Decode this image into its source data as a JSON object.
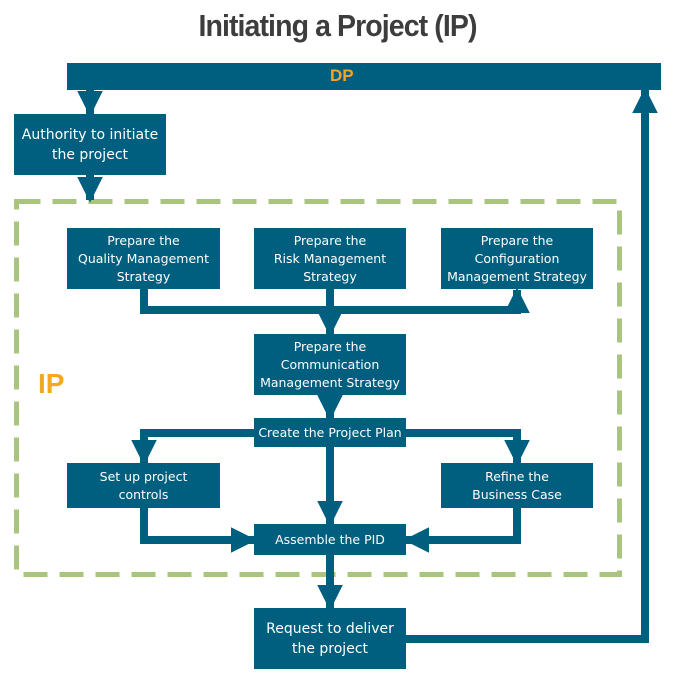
{
  "title": "Initiating a Project (IP)",
  "colors": {
    "box": "#005f7f",
    "box_text": "#ffffff",
    "accent_label": "#f5a623",
    "dashed_border": "#a8c47e",
    "title": "#3d3d3d"
  },
  "dp_bar": {
    "label": "DP"
  },
  "ip_region": {
    "label": "IP"
  },
  "nodes": {
    "authority": "Authority to initiate\nthe project",
    "quality": "Prepare the\nQuality Management\nStrategy",
    "risk": "Prepare the\nRisk Management\nStrategy",
    "configuration": "Prepare the\nConfiguration\nManagement Strategy",
    "communication": "Prepare the\nCommunication\nManagement Strategy",
    "project_plan": "Create the Project Plan",
    "controls": "Set up project\ncontrols",
    "business_case": "Refine the\nBusiness Case",
    "assemble_pid": "Assemble the PID",
    "request_deliver": "Request to deliver\nthe project"
  },
  "edges": [
    [
      "DP",
      "authority"
    ],
    [
      "authority",
      "IP"
    ],
    [
      "quality",
      "communication"
    ],
    [
      "risk",
      "communication"
    ],
    [
      "quality",
      "configuration"
    ],
    [
      "communication",
      "project_plan"
    ],
    [
      "project_plan",
      "controls"
    ],
    [
      "project_plan",
      "business_case"
    ],
    [
      "project_plan",
      "assemble_pid"
    ],
    [
      "controls",
      "assemble_pid"
    ],
    [
      "business_case",
      "assemble_pid"
    ],
    [
      "assemble_pid",
      "request_deliver"
    ],
    [
      "request_deliver",
      "DP"
    ]
  ]
}
